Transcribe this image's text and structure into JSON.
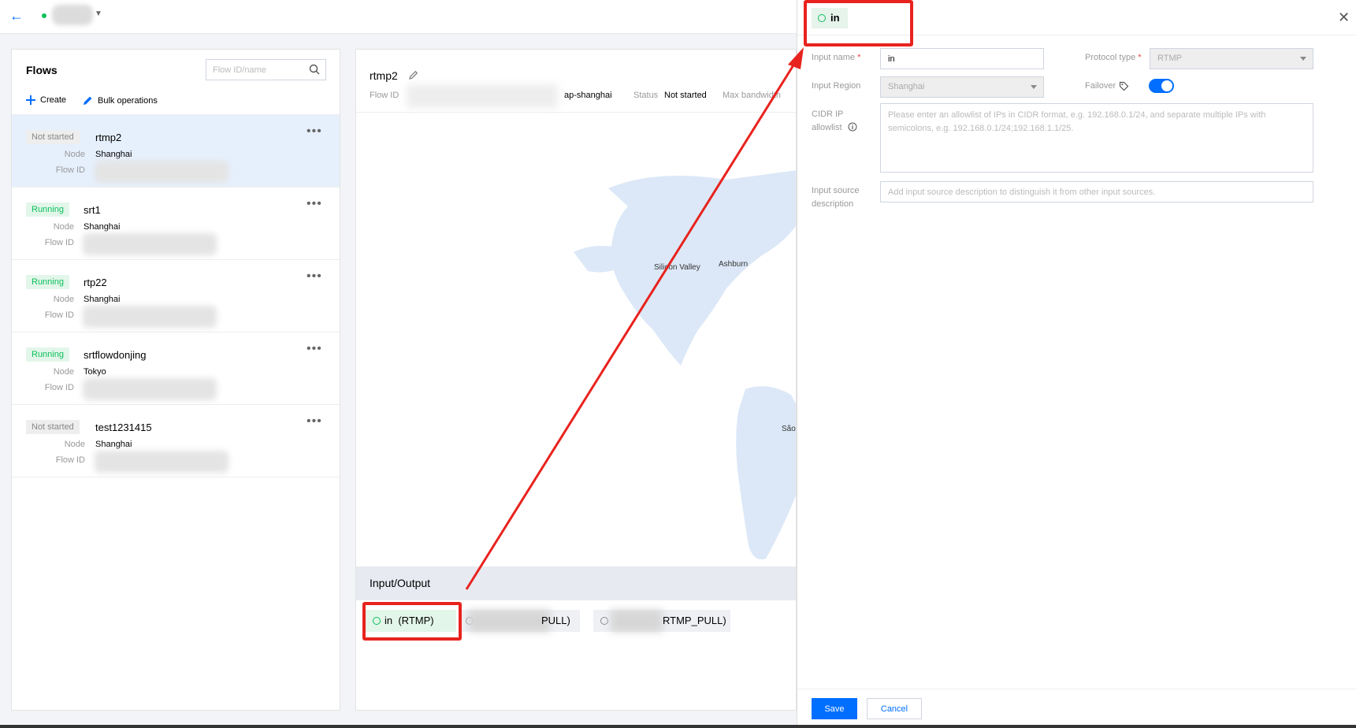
{
  "flows": {
    "title": "Flows",
    "search_placeholder": "Flow ID/name",
    "create_label": "Create",
    "bulk_label": "Bulk operations",
    "node_label": "Node",
    "flowid_label": "Flow ID",
    "items": [
      {
        "status": "Not started",
        "name": "rtmp2",
        "node": "Shanghai"
      },
      {
        "status": "Running",
        "name": "srt1",
        "node": "Shanghai"
      },
      {
        "status": "Running",
        "name": "rtp22",
        "node": "Shanghai"
      },
      {
        "status": "Running",
        "name": "srtflowdonjing",
        "node": "Tokyo"
      },
      {
        "status": "Not started",
        "name": "test1231415",
        "node": "Shanghai"
      }
    ]
  },
  "detail": {
    "name": "rtmp2",
    "flowid_label": "Flow ID",
    "region_value": "ap-shanghai",
    "status_label": "Status",
    "status_value": "Not started",
    "bandwidth_label": "Max bandwidth",
    "map_labels": {
      "silicon_valley": "Silicon Valley",
      "ashburn": "Ashburn",
      "sao_paulo": "São Paulo"
    },
    "io_title": "Input/Output",
    "io_items": [
      {
        "label": "in  (RTMP)"
      },
      {
        "label": "PULL)"
      },
      {
        "label": "RTMP_PULL)"
      }
    ]
  },
  "drawer": {
    "tag_label": "in",
    "input_name_label": "Input name",
    "input_name_value": "in",
    "protocol_label": "Protocol type",
    "protocol_value": "RTMP",
    "region_label": "Input Region",
    "region_value": "Shanghai",
    "failover_label": "Failover",
    "failover_on": true,
    "cidr_label_1": "CIDR IP",
    "cidr_label_2": "allowlist",
    "cidr_placeholder": "Please enter an allowlist of IPs in CIDR format, e.g. 192.168.0.1/24, and separate multiple IPs with semicolons, e.g. 192.168.0.1/24;192.168.1.1/25.",
    "desc_label_1": "Input source",
    "desc_label_2": "description",
    "desc_placeholder": "Add input source description to distinguish it from other input sources.",
    "save_label": "Save",
    "cancel_label": "Cancel"
  },
  "colors": {
    "primary": "#006eff",
    "running": "#0abf5b",
    "selected_bg": "#e6f0fd",
    "annotation": "#e8231e"
  }
}
